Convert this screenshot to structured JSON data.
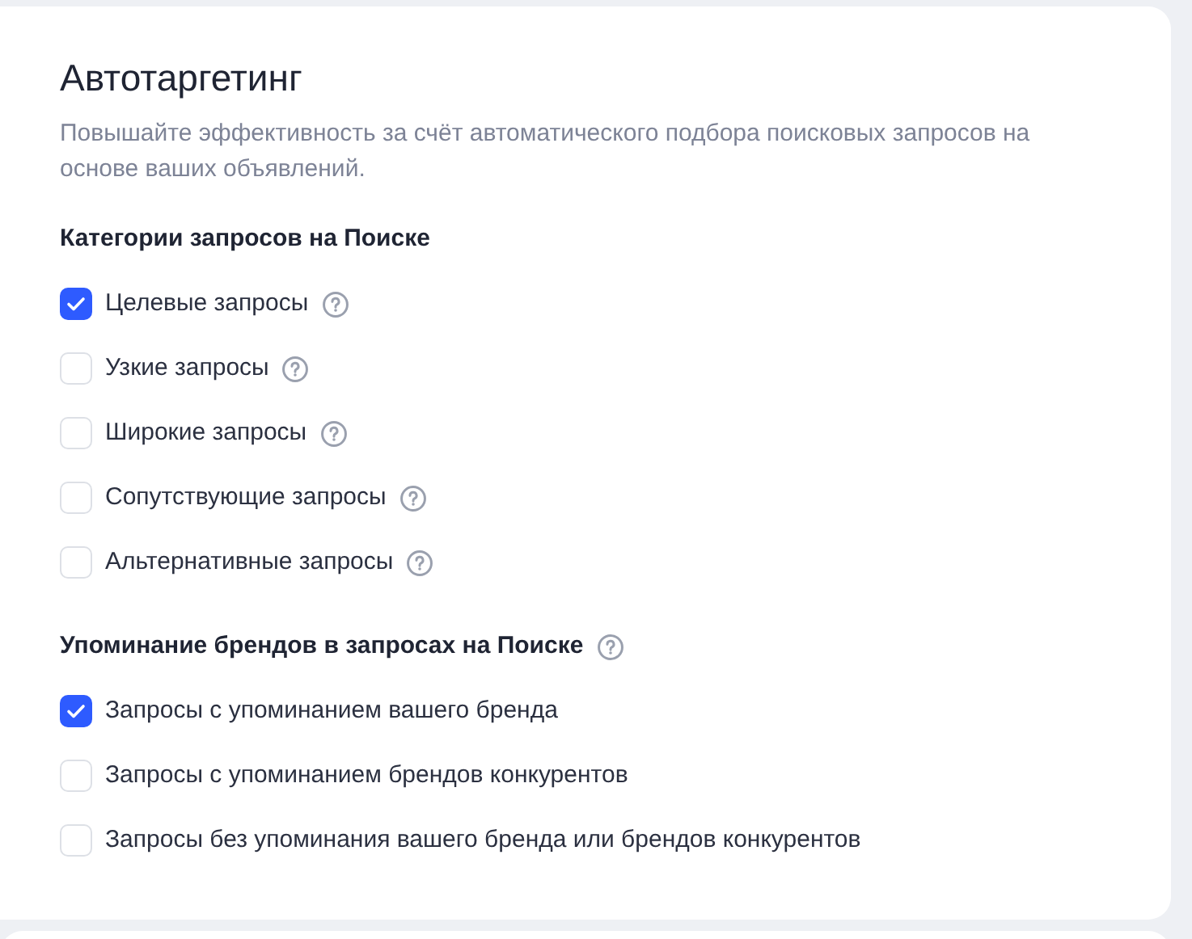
{
  "title": "Автотаргетинг",
  "description": "Повышайте эффективность за счёт автоматического подбора поисковых запросов на основе ваших объявлений.",
  "sections": [
    {
      "heading": "Категории запросов на Поиске",
      "help": false,
      "options": [
        {
          "label": "Целевые запросы",
          "checked": true,
          "help": true
        },
        {
          "label": "Узкие запросы",
          "checked": false,
          "help": true
        },
        {
          "label": "Широкие запросы",
          "checked": false,
          "help": true
        },
        {
          "label": "Сопутствующие запросы",
          "checked": false,
          "help": true
        },
        {
          "label": "Альтернативные запросы",
          "checked": false,
          "help": true
        }
      ]
    },
    {
      "heading": "Упоминание брендов в запросах на Поиске",
      "help": true,
      "options": [
        {
          "label": "Запросы с упоминанием вашего бренда",
          "checked": true,
          "help": false
        },
        {
          "label": "Запросы с упоминанием брендов конкурентов",
          "checked": false,
          "help": false
        },
        {
          "label": "Запросы без упоминания вашего бренда или брендов конкурентов",
          "checked": false,
          "help": false
        }
      ]
    }
  ]
}
